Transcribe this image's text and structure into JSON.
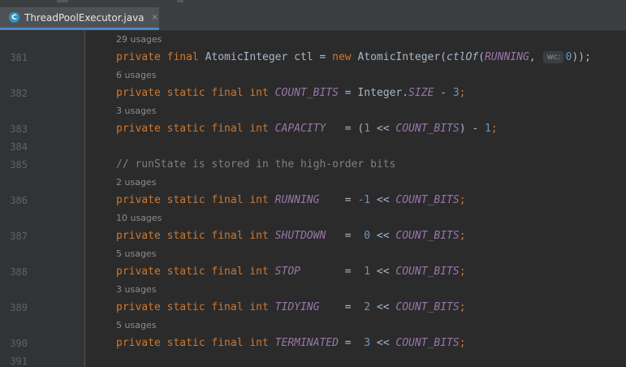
{
  "tab": {
    "title": "ThreadPoolExecutor.java",
    "icon_letter": "C",
    "close_glyph": "×"
  },
  "lines": [
    {
      "type": "usage",
      "text": "29 usages"
    },
    {
      "type": "code",
      "num": "381",
      "tokens": [
        {
          "t": "private final ",
          "c": "kw"
        },
        {
          "t": "AtomicInteger ctl = "
        },
        {
          "t": "new ",
          "c": "kw"
        },
        {
          "t": "AtomicInteger("
        },
        {
          "t": "ctlOf",
          "c": "m"
        },
        {
          "t": "("
        },
        {
          "t": "RUNNING",
          "c": "c"
        },
        {
          "t": ", "
        },
        {
          "t": "wc:",
          "c": "hint"
        },
        {
          "t": "0",
          "c": "n"
        },
        {
          "t": "));"
        }
      ]
    },
    {
      "type": "usage",
      "text": "6 usages"
    },
    {
      "type": "code",
      "num": "382",
      "tokens": [
        {
          "t": "private static final int ",
          "c": "kw"
        },
        {
          "t": "COUNT_BITS",
          "c": "c"
        },
        {
          "t": " = Integer."
        },
        {
          "t": "SIZE",
          "c": "c"
        },
        {
          "t": " - "
        },
        {
          "t": "3",
          "c": "n"
        },
        {
          "t": ";",
          "c": "kw"
        }
      ]
    },
    {
      "type": "usage",
      "text": "3 usages"
    },
    {
      "type": "code",
      "num": "383",
      "tokens": [
        {
          "t": "private static final int ",
          "c": "kw"
        },
        {
          "t": "CAPACITY",
          "c": "c"
        },
        {
          "t": "   = ("
        },
        {
          "t": "1",
          "c": "n"
        },
        {
          "t": " << "
        },
        {
          "t": "COUNT_BITS",
          "c": "c"
        },
        {
          "t": ") - "
        },
        {
          "t": "1",
          "c": "n"
        },
        {
          "t": ";",
          "c": "kw"
        }
      ]
    },
    {
      "type": "code",
      "num": "384",
      "tokens": []
    },
    {
      "type": "code",
      "num": "385",
      "tokens": [
        {
          "t": "// runState is stored in the high-order bits",
          "c": "cm"
        }
      ]
    },
    {
      "type": "usage",
      "text": "2 usages"
    },
    {
      "type": "code",
      "num": "386",
      "tokens": [
        {
          "t": "private static final int ",
          "c": "kw"
        },
        {
          "t": "RUNNING",
          "c": "c"
        },
        {
          "t": "    = "
        },
        {
          "t": "-1",
          "c": "n"
        },
        {
          "t": " << "
        },
        {
          "t": "COUNT_BITS",
          "c": "c"
        },
        {
          "t": ";",
          "c": "kw"
        }
      ]
    },
    {
      "type": "usage",
      "text": "10 usages"
    },
    {
      "type": "code",
      "num": "387",
      "tokens": [
        {
          "t": "private static final int ",
          "c": "kw"
        },
        {
          "t": "SHUTDOWN",
          "c": "c"
        },
        {
          "t": "   =  "
        },
        {
          "t": "0",
          "c": "n"
        },
        {
          "t": " << "
        },
        {
          "t": "COUNT_BITS",
          "c": "c"
        },
        {
          "t": ";",
          "c": "kw"
        }
      ]
    },
    {
      "type": "usage",
      "text": "5 usages"
    },
    {
      "type": "code",
      "num": "388",
      "tokens": [
        {
          "t": "private static final int ",
          "c": "kw"
        },
        {
          "t": "STOP",
          "c": "c"
        },
        {
          "t": "       =  "
        },
        {
          "t": "1",
          "c": "n"
        },
        {
          "t": " << "
        },
        {
          "t": "COUNT_BITS",
          "c": "c"
        },
        {
          "t": ";",
          "c": "kw"
        }
      ]
    },
    {
      "type": "usage",
      "text": "3 usages"
    },
    {
      "type": "code",
      "num": "389",
      "tokens": [
        {
          "t": "private static final int ",
          "c": "kw"
        },
        {
          "t": "TIDYING",
          "c": "c"
        },
        {
          "t": "    =  "
        },
        {
          "t": "2",
          "c": "n"
        },
        {
          "t": " << "
        },
        {
          "t": "COUNT_BITS",
          "c": "c"
        },
        {
          "t": ";",
          "c": "kw"
        }
      ]
    },
    {
      "type": "usage",
      "text": "5 usages"
    },
    {
      "type": "code",
      "num": "390",
      "tokens": [
        {
          "t": "private static final int ",
          "c": "kw"
        },
        {
          "t": "TERMINATED",
          "c": "c"
        },
        {
          "t": " =  "
        },
        {
          "t": "3",
          "c": "n"
        },
        {
          "t": " << "
        },
        {
          "t": "COUNT_BITS",
          "c": "c"
        },
        {
          "t": ";",
          "c": "kw"
        }
      ]
    },
    {
      "type": "code",
      "num": "391",
      "tokens": []
    }
  ]
}
